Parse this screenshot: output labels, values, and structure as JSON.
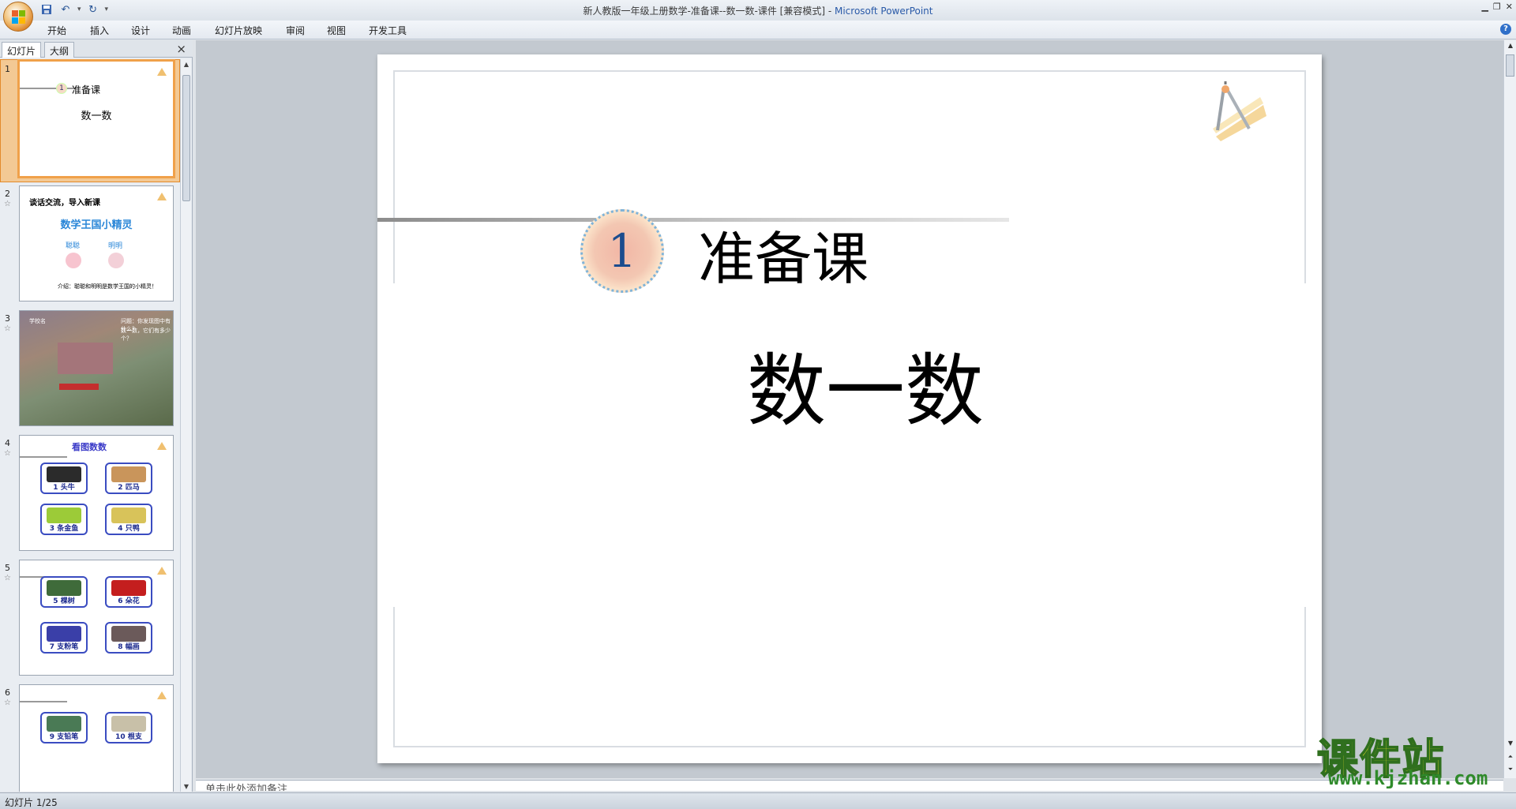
{
  "window": {
    "title_doc": "新人教版一年级上册数学-准备课--数一数-课件 [兼容模式]",
    "title_sep": " - ",
    "title_app": "Microsoft PowerPoint"
  },
  "ribbon": {
    "tabs": [
      "开始",
      "插入",
      "设计",
      "动画",
      "幻灯片放映",
      "审阅",
      "视图",
      "开发工具"
    ]
  },
  "left_pane": {
    "tabs": [
      "幻灯片",
      "大纲"
    ],
    "close": "×"
  },
  "thumbnails": [
    {
      "num": "1",
      "line1": "准备课",
      "line2": "数一数",
      "circle": "1"
    },
    {
      "num": "2",
      "title": "谈话交流，导入新课",
      "subtitle": "数学王国小精灵",
      "left": "聪聪",
      "right": "明明",
      "footer": "介绍：聪聪和明明是数学王国的小精灵！"
    },
    {
      "num": "3",
      "q1": "问题：你发现图中有什么？",
      "q2": "数一数，它们有多少个？",
      "label": "学校名"
    },
    {
      "num": "4",
      "title": "看图数数",
      "cards": [
        {
          "n": "1",
          "t": "头牛"
        },
        {
          "n": "2",
          "t": "匹马"
        },
        {
          "n": "3",
          "t": "条金鱼"
        },
        {
          "n": "4",
          "t": "只鸭"
        }
      ]
    },
    {
      "num": "5",
      "cards": [
        {
          "n": "5",
          "t": "棵树"
        },
        {
          "n": "6",
          "t": "朵花"
        },
        {
          "n": "7",
          "t": "支粉笔"
        },
        {
          "n": "8",
          "t": "幅画"
        }
      ]
    },
    {
      "num": "6",
      "cards": [
        {
          "n": "9",
          "t": "支铅笔"
        },
        {
          "n": "10",
          "t": "根支"
        }
      ]
    }
  ],
  "slide": {
    "number_badge": "1",
    "lesson": "准备课",
    "topic": "数一数"
  },
  "notes": {
    "placeholder": "单击此处添加备注"
  },
  "status": {
    "slide_info": "幻灯片 1/25"
  },
  "watermark": {
    "brand": "课件站",
    "url": "www.kjzhan.com"
  },
  "colors": {
    "accent_orange": "#f0a14a",
    "slide_blue": "#1b4c8e",
    "watermark_yellow": "#f7ea2c"
  }
}
